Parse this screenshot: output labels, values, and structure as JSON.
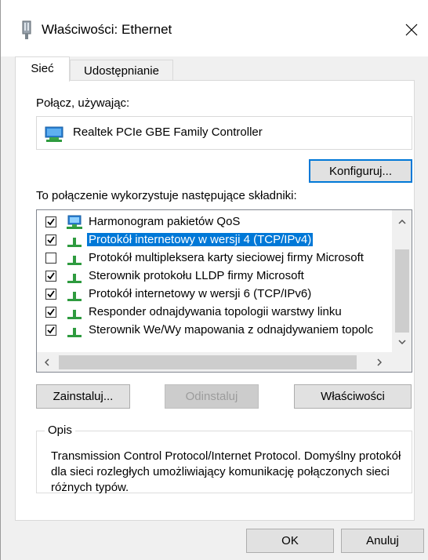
{
  "window": {
    "title": "Właściwości: Ethernet"
  },
  "tabs": [
    {
      "label": "Sieć"
    },
    {
      "label": "Udostępnianie"
    }
  ],
  "connect_using": {
    "label": "Połącz, używając:",
    "adapter": "Realtek PCIe GBE Family Controller",
    "configure_button": "Konfiguruj..."
  },
  "components": {
    "label": "To połączenie wykorzystuje następujące składniki:",
    "items": [
      {
        "label": "Harmonogram pakietów QoS",
        "checked": true,
        "selected": false,
        "icon": "network-monitor-icon"
      },
      {
        "label": "Protokół internetowy w wersji 4 (TCP/IPv4)",
        "checked": true,
        "selected": true,
        "icon": "protocol-icon"
      },
      {
        "label": "Protokół multipleksera karty sieciowej firmy Microsoft",
        "checked": false,
        "selected": false,
        "icon": "protocol-icon"
      },
      {
        "label": "Sterownik protokołu LLDP firmy Microsoft",
        "checked": true,
        "selected": false,
        "icon": "protocol-icon"
      },
      {
        "label": "Protokół internetowy w wersji 6 (TCP/IPv6)",
        "checked": true,
        "selected": false,
        "icon": "protocol-icon"
      },
      {
        "label": "Responder odnajdywania topologii warstwy linku",
        "checked": true,
        "selected": false,
        "icon": "protocol-icon"
      },
      {
        "label": "Sterownik We/Wy mapowania z odnajdywaniem topolc",
        "checked": true,
        "selected": false,
        "icon": "protocol-icon"
      }
    ]
  },
  "actions": {
    "install": "Zainstaluj...",
    "uninstall": "Odinstaluj",
    "properties": "Właściwości"
  },
  "description": {
    "title": "Opis",
    "text": "Transmission Control Protocol/Internet Protocol. Domyślny protokół dla sieci rozległych umożliwiający komunikację połączonych sieci różnych typów."
  },
  "footer": {
    "ok": "OK",
    "cancel": "Anuluj"
  },
  "colors": {
    "selection": "#0078d7",
    "accent_border": "#0078d7",
    "protocol_green": "#2e9b3f"
  }
}
